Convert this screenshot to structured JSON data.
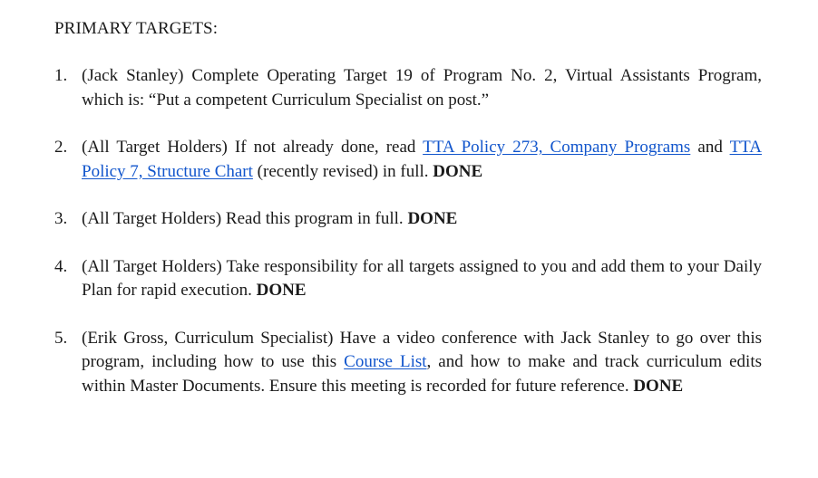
{
  "document": {
    "heading": "PRIMARY TARGETS:",
    "items": [
      {
        "number": "1.",
        "holder": "(Jack Stanley)",
        "text": " Complete Operating Target 19 of Program No. 2, Virtual Assistants Program, which is: “Put a competent Curriculum Specialist on post.”"
      },
      {
        "number": "2.",
        "holder": "(All Target Holders)",
        "text_a": " If not already done, read ",
        "link1": "TTA Policy 273, Company Programs",
        "text_b": " and ",
        "link2": "TTA Policy 7, Structure Chart",
        "text_c": " (recently revised) in full. ",
        "status": "DONE"
      },
      {
        "number": "3.",
        "holder": "(All Target Holders)",
        "text": " Read this program in full. ",
        "status": "DONE"
      },
      {
        "number": "4.",
        "holder": "(All Target Holders)",
        "text": " Take responsibility for all targets assigned to you and add them to your Daily Plan for rapid execution. ",
        "status": "DONE"
      },
      {
        "number": "5.",
        "holder": "(Erik Gross, Curriculum Specialist)",
        "text_a": " Have a video conference with Jack Stanley to go over this program, including how to use this ",
        "link1": "Course List",
        "text_b": ", and how to make and track curriculum edits within Master Documents. Ensure this meeting is recorded for future reference. ",
        "status": "DONE"
      }
    ]
  },
  "colors": {
    "link": "#1155cc",
    "text": "#1a1a1a",
    "background": "#ffffff"
  }
}
